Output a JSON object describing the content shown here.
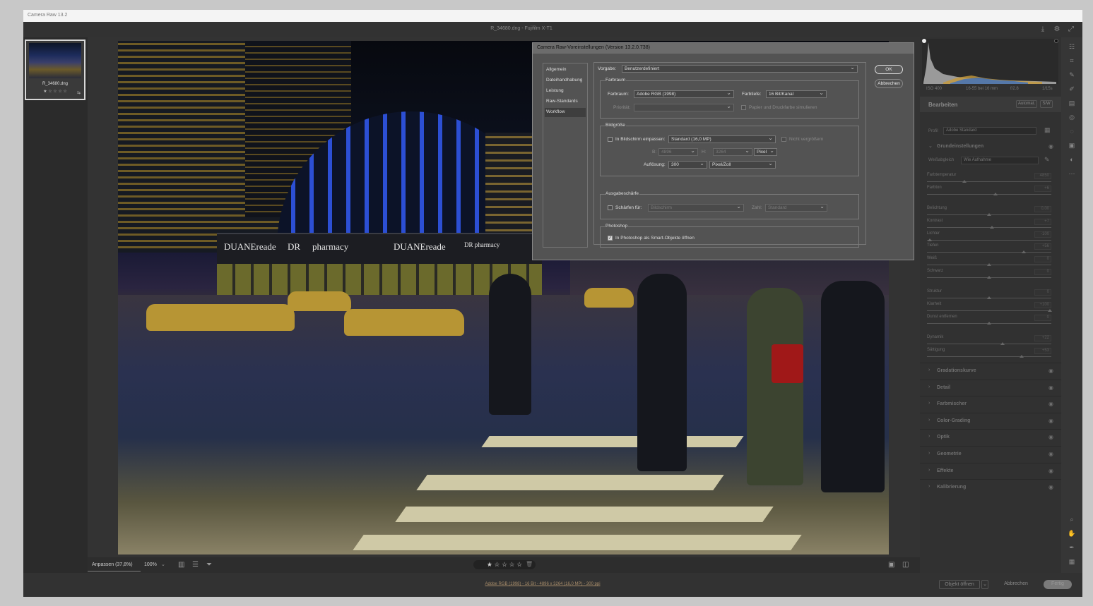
{
  "window": {
    "title": "Camera Raw 13.2",
    "file_caption": "R_34680.dng  -  Fujifilm X-T1"
  },
  "filmstrip": {
    "thumb_name": "R_34680.dng",
    "thumb_stars": "★ ☆ ☆ ☆ ☆"
  },
  "photo": {
    "signs": [
      "DUANEreade",
      "DR",
      "pharmacy",
      "DUANEreade",
      "DR pharmacy"
    ]
  },
  "bottombar": {
    "zoom_fit": "Anpassen (37,8%)",
    "zoom_value": "100%",
    "rating": "★ ☆ ☆ ☆ ☆"
  },
  "histogram": {
    "iso": "ISO 400",
    "focal": "16-55 bei 16 mm",
    "aperture": "f/2.8",
    "shutter": "1/15s"
  },
  "panel": {
    "title": "Bearbeiten",
    "auto_label": "Automat.",
    "bw_label": "S/W",
    "profile_label": "Profil",
    "profile_value": "Adobe Standard",
    "basic_section": "Grundeinstellungen",
    "wb_label": "Weißabgleich",
    "wb_value": "Wie Aufnahme",
    "sliders": [
      {
        "name": "Farbtemperatur",
        "value": "4850",
        "pos": 0.3
      },
      {
        "name": "Farbton",
        "value": "+6",
        "pos": 0.55
      },
      {
        "name": "Belichtung",
        "value": "0,00",
        "pos": 0.5
      },
      {
        "name": "Kontrast",
        "value": "+7",
        "pos": 0.52
      },
      {
        "name": "Lichter",
        "value": "-100",
        "pos": 0.02
      },
      {
        "name": "Tiefen",
        "value": "+56",
        "pos": 0.78
      },
      {
        "name": "Weiß",
        "value": "0",
        "pos": 0.5
      },
      {
        "name": "Schwarz",
        "value": "0",
        "pos": 0.5
      },
      {
        "name": "Struktur",
        "value": "0",
        "pos": 0.5
      },
      {
        "name": "Klarheit",
        "value": "+100",
        "pos": 0.99
      },
      {
        "name": "Dunst entfernen",
        "value": "0",
        "pos": 0.5
      },
      {
        "name": "Dynamik",
        "value": "+22",
        "pos": 0.61
      },
      {
        "name": "Sättigung",
        "value": "+53",
        "pos": 0.76
      }
    ],
    "sections": [
      "Gradationskurve",
      "Detail",
      "Farbmischer",
      "Color-Grading",
      "Optik",
      "Geometrie",
      "Effekte",
      "Kalibrierung"
    ]
  },
  "footer": {
    "info": "Adobe RGB (1998) - 16 Bit - 4896 x 3264 (16,0 MP) - 300 ppi",
    "open_button": "Objekt öffnen",
    "cancel_button": "Abbrechen",
    "done_button": "Fertig"
  },
  "dialog": {
    "title": "Camera Raw-Voreinstellungen  (Version 13.2.0.738)",
    "nav": [
      "Allgemein",
      "Dateihandhabung",
      "Leistung",
      "Raw-Standards",
      "Workflow"
    ],
    "preset_label": "Vorgabe:",
    "preset_value": "Benutzerdefiniert",
    "ok": "OK",
    "cancel": "Abbrechen",
    "colorspace_group": "Farbraum",
    "colorspace_label": "Farbraum:",
    "colorspace_value": "Adobe RGB (1998)",
    "depth_label": "Farbtiefe:",
    "depth_value": "16 Bit/Kanal",
    "priority_label": "Priorität:",
    "simulate_label": "Papier und Druckfarbe simulieren",
    "size_group": "Bildgröße",
    "fit_label": "In Bildschirm einpassen:",
    "fit_value": "Standard  (16,0 MP)",
    "no_enlarge": "Nicht vergrößern",
    "w_label": "B:",
    "w_value": "4896",
    "h_label": "H:",
    "h_value": "3264",
    "unit_value": "Pixel",
    "res_label": "Auflösung:",
    "res_value": "300",
    "res_unit": "Pixel/Zoll",
    "sharpen_group": "Ausgabeschärfe",
    "sharpen_label": "Schärfen für:",
    "sharpen_value": "Bildschirm",
    "amount_label": "Zahl:",
    "amount_value": "Standard",
    "ps_group": "Photoshop",
    "smart_label": "In Photoshop als Smart-Objekte öffnen"
  }
}
